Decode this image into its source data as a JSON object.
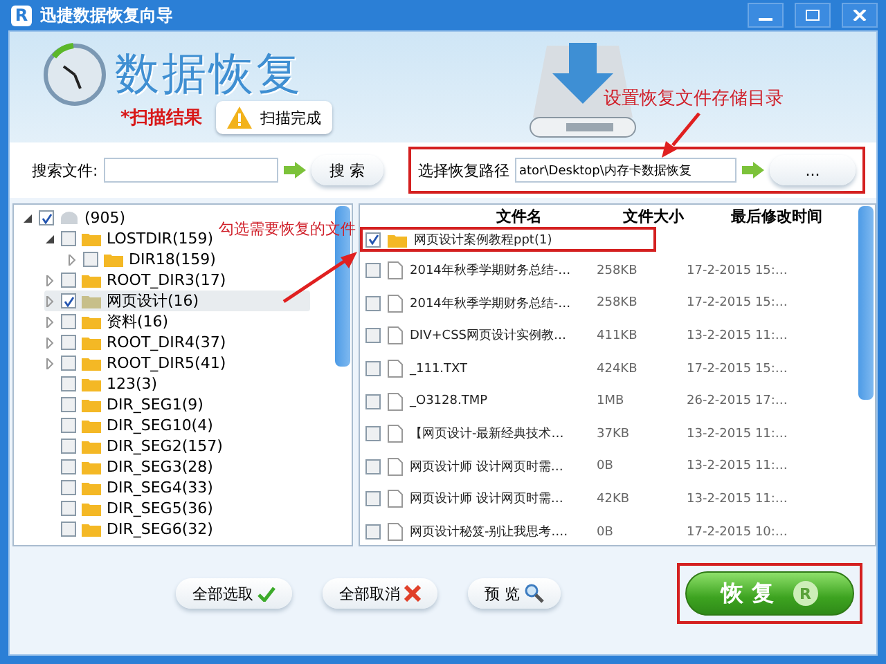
{
  "window": {
    "app_logo": "R",
    "title": "迅捷数据恢复向导"
  },
  "header": {
    "title": "数据恢复",
    "subtitle": "*扫描结果",
    "tooltip": "扫描完成"
  },
  "annotations": [
    {
      "text": "设置恢复文件存储目录"
    },
    {
      "text": "勾选需要恢复的文件"
    }
  ],
  "search": {
    "label": "搜索文件:",
    "button": "搜 索"
  },
  "restore_path": {
    "label": "选择恢复路径",
    "value": "ator\\Desktop\\内存卡数据恢复",
    "button": "..."
  },
  "tree": [
    {
      "label": "(905)",
      "kind": "drive",
      "expanded": true,
      "checked": true,
      "selected": false,
      "children": [
        {
          "label": "LOSTDIR(159)",
          "kind": "folder",
          "expanded": true,
          "checked": false,
          "selected": false,
          "children": [
            {
              "label": "DIR18(159)",
              "kind": "folder",
              "expanded": false,
              "checked": false,
              "selected": false
            }
          ]
        },
        {
          "label": "ROOT_DIR3(17)",
          "kind": "folder",
          "expanded": false,
          "checked": false,
          "selected": false
        },
        {
          "label": "网页设计(16)",
          "kind": "folder",
          "expanded": false,
          "checked": true,
          "selected": true
        },
        {
          "label": "资料(16)",
          "kind": "folder",
          "expanded": false,
          "checked": false,
          "selected": false
        },
        {
          "label": "ROOT_DIR4(37)",
          "kind": "folder",
          "expanded": false,
          "checked": false,
          "selected": false
        },
        {
          "label": "ROOT_DIR5(41)",
          "kind": "folder",
          "expanded": false,
          "checked": false,
          "selected": false
        },
        {
          "label": "123(3)",
          "kind": "folder",
          "checked": false,
          "selected": false
        },
        {
          "label": "DIR_SEG1(9)",
          "kind": "folder",
          "checked": false,
          "selected": false
        },
        {
          "label": "DIR_SEG10(4)",
          "kind": "folder",
          "checked": false,
          "selected": false
        },
        {
          "label": "DIR_SEG2(157)",
          "kind": "folder",
          "checked": false,
          "selected": false
        },
        {
          "label": "DIR_SEG3(28)",
          "kind": "folder",
          "checked": false,
          "selected": false
        },
        {
          "label": "DIR_SEG4(33)",
          "kind": "folder",
          "checked": false,
          "selected": false
        },
        {
          "label": "DIR_SEG5(36)",
          "kind": "folder",
          "checked": false,
          "selected": false
        },
        {
          "label": "DIR_SEG6(32)",
          "kind": "folder",
          "checked": false,
          "selected": false
        }
      ]
    }
  ],
  "files": {
    "columns": [
      "文件名",
      "文件大小",
      "最后修改时间"
    ],
    "rows": [
      {
        "kind": "folder",
        "checked": true,
        "name": "网页设计案例教程ppt(1)"
      },
      {
        "kind": "file",
        "checked": false,
        "name": "2014年秋季学期财务总结-…",
        "size": "258KB",
        "modified": "17-2-2015 15:…"
      },
      {
        "kind": "file",
        "checked": false,
        "name": "2014年秋季学期财务总结-…",
        "size": "258KB",
        "modified": "17-2-2015 15:…"
      },
      {
        "kind": "file",
        "checked": false,
        "name": "DIV+CSS网页设计实例教…",
        "size": "411KB",
        "modified": "13-2-2015 11:…"
      },
      {
        "kind": "file",
        "checked": false,
        "name": "_111.TXT",
        "size": "424KB",
        "modified": "17-2-2015 15:…"
      },
      {
        "kind": "file",
        "checked": false,
        "name": "_O3128.TMP",
        "size": "1MB",
        "modified": "26-2-2015 17:…"
      },
      {
        "kind": "file",
        "checked": false,
        "name": "【网页设计-最新经典技术…",
        "size": "37KB",
        "modified": "13-2-2015 11:…"
      },
      {
        "kind": "file",
        "checked": false,
        "name": "网页设计师 设计网页时需…",
        "size": "0B",
        "modified": "13-2-2015 11:…"
      },
      {
        "kind": "file",
        "checked": false,
        "name": "网页设计师 设计网页时需…",
        "size": "42KB",
        "modified": "13-2-2015 11:…"
      },
      {
        "kind": "file",
        "checked": false,
        "name": "网页设计秘笈-别让我思考.…",
        "size": "0B",
        "modified": "17-2-2015 10:…"
      }
    ]
  },
  "actions": [
    {
      "label": "全部选取",
      "kind": "check"
    },
    {
      "label": "全部取消",
      "kind": "cross"
    },
    {
      "label": "预 览",
      "kind": "search"
    }
  ],
  "recover": {
    "label": "恢 复",
    "badge": "R"
  }
}
